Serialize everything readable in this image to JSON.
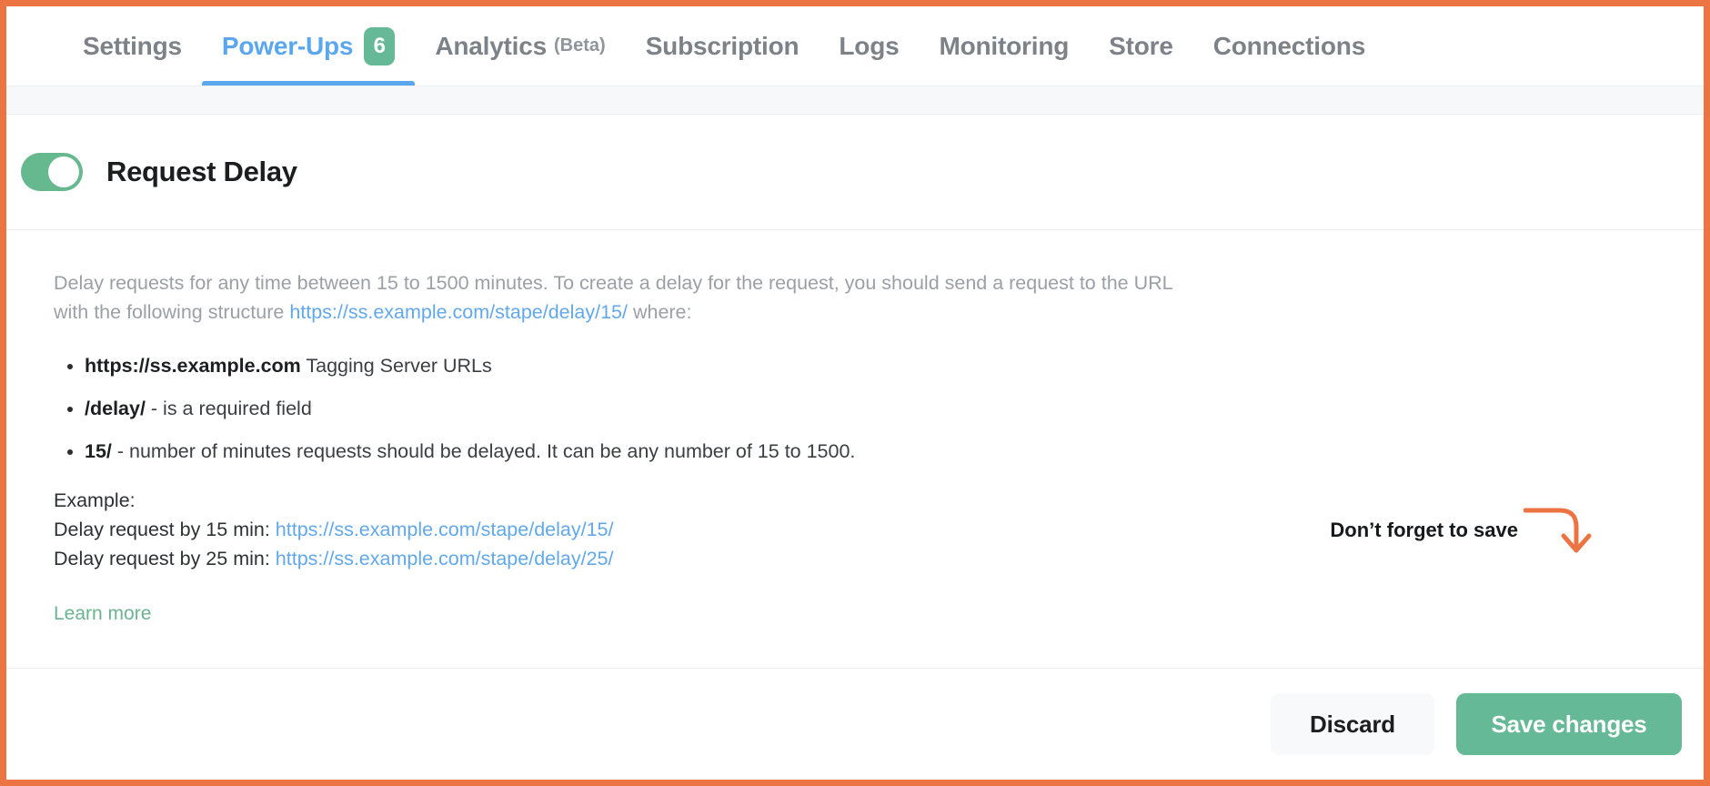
{
  "theme": {
    "frame_border": "#ec7442",
    "accent_green": "#65b996",
    "accent_blue": "#5aa7ee",
    "link_blue": "#62a8ea",
    "annotation_orange": "#ec7442"
  },
  "tabs": [
    {
      "label": "Settings",
      "sub": "",
      "badge": "",
      "active": false
    },
    {
      "label": "Power-Ups",
      "sub": "",
      "badge": "6",
      "active": true
    },
    {
      "label": "Analytics",
      "sub": "(Beta)",
      "badge": "",
      "active": false
    },
    {
      "label": "Subscription",
      "sub": "",
      "badge": "",
      "active": false
    },
    {
      "label": "Logs",
      "sub": "",
      "badge": "",
      "active": false
    },
    {
      "label": "Monitoring",
      "sub": "",
      "badge": "",
      "active": false
    },
    {
      "label": "Store",
      "sub": "",
      "badge": "",
      "active": false
    },
    {
      "label": "Connections",
      "sub": "",
      "badge": "",
      "active": false
    }
  ],
  "power_up": {
    "title": "Request Delay",
    "toggle_state": "on",
    "intro": {
      "part1": "Delay requests for any time between 15 to 1500 minutes. To create a delay for the request, you should send a request to the URL with the following structure ",
      "link": "https://ss.example.com/stape/delay/15/",
      "part2": " where:"
    },
    "bullets": [
      {
        "strong": "https://ss.example.com",
        "rest": " Tagging Server URLs"
      },
      {
        "strong": "/delay/",
        "rest": " - is a required field"
      },
      {
        "strong": "15/",
        "rest": " - number of minutes requests should be delayed. It can be any number of 15 to 1500."
      }
    ],
    "examples": {
      "heading": "Example:",
      "rows": [
        {
          "label": "Delay request by 15 min: ",
          "link": "https://ss.example.com/stape/delay/15/"
        },
        {
          "label": "Delay request by 25 min: ",
          "link": "https://ss.example.com/stape/delay/25/"
        }
      ]
    },
    "learn_more": "Learn more"
  },
  "annotation": {
    "text": "Don’t forget to save",
    "arrow_icon": "curved-arrow-down-icon"
  },
  "footer": {
    "discard_label": "Discard",
    "save_label": "Save changes"
  }
}
